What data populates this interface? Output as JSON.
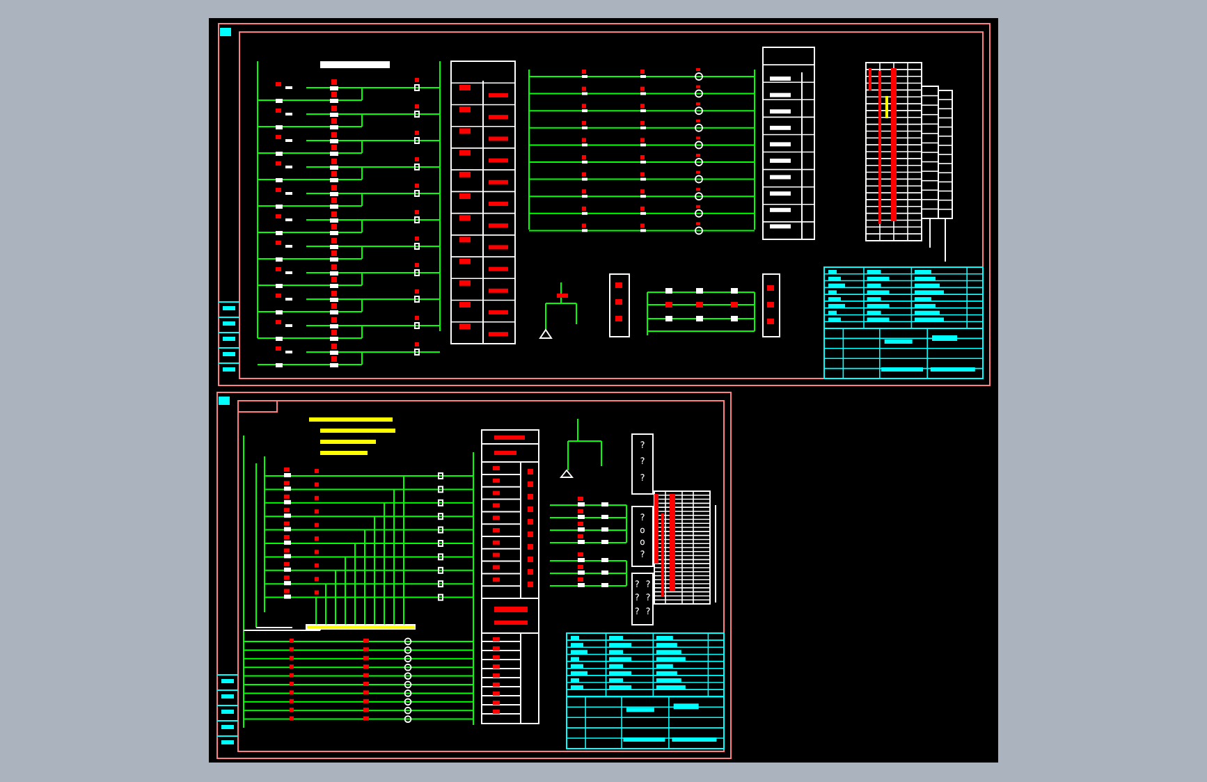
{
  "drawing_area": {
    "sheets": [
      {
        "kind": "wide"
      },
      {
        "kind": "narrow",
        "symbol_boxes": [
          {
            "lines": [
              "?",
              "?",
              "?"
            ]
          },
          {
            "lines": [
              "?",
              "o",
              "o",
              "?"
            ]
          },
          {
            "lines": [
              "? ?",
              "? ?",
              "? ?"
            ]
          }
        ]
      }
    ]
  }
}
